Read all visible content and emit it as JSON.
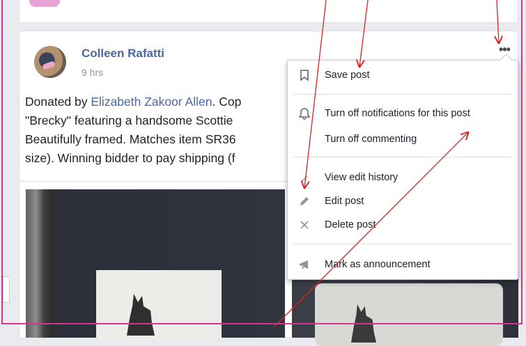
{
  "post": {
    "author": "Colleen Rafatti",
    "time": "9 hrs",
    "text_lines": [
      [
        "Donated by ",
        "Elizabeth Zakoor Allen",
        ". Cop"
      ],
      [
        "\"Brecky\" featuring a handsome Scottie"
      ],
      [
        "Beautifully framed. Matches item SR36"
      ],
      [
        "size). Winning bidder to pay shipping (f"
      ]
    ],
    "options_button": "•••"
  },
  "menu": {
    "items": [
      {
        "label": "Save post",
        "icon": "bookmark-icon"
      },
      {
        "label": "Turn off notifications for this post",
        "icon": "bell-icon"
      },
      {
        "label": "Turn off commenting",
        "icon": "none"
      },
      {
        "label": "View edit history",
        "icon": "history-icon"
      },
      {
        "label": "Edit post",
        "icon": "pencil-icon"
      },
      {
        "label": "Delete post",
        "icon": "x-icon"
      },
      {
        "label": "Mark as announcement",
        "icon": "megaphone-icon"
      }
    ]
  },
  "colors": {
    "link": "#4b67a1",
    "annotation_arrow": "#e02020",
    "frame": "#d6338f"
  }
}
